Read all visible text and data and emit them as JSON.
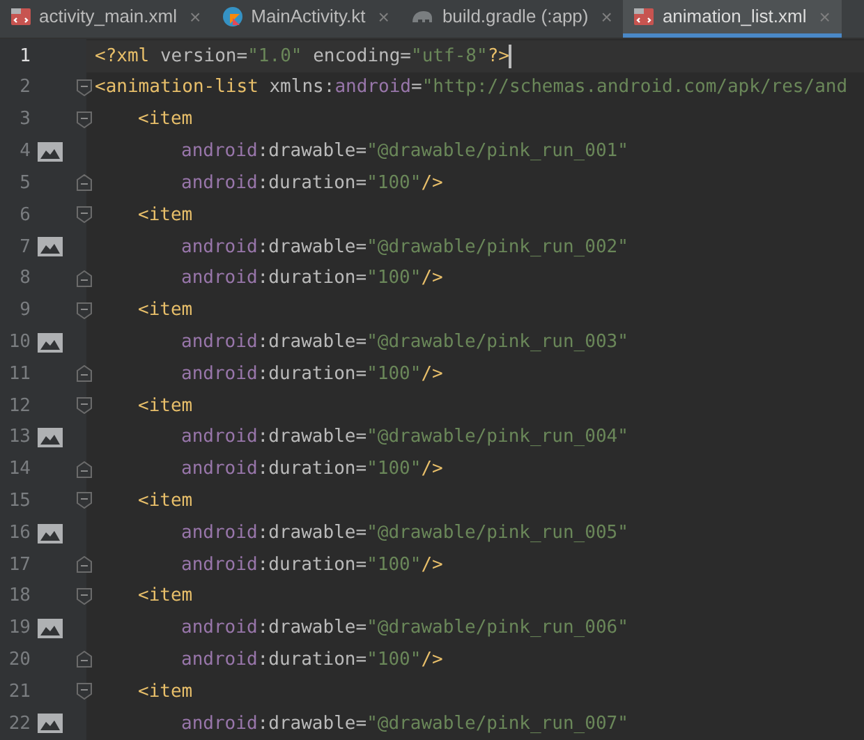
{
  "tabs": [
    {
      "label": "activity_main.xml",
      "kind": "xml",
      "selected": false,
      "close": "×"
    },
    {
      "label": "MainActivity.kt",
      "kind": "kotlin",
      "selected": false,
      "close": "×"
    },
    {
      "label": "build.gradle (:app)",
      "kind": "gradle",
      "selected": false,
      "close": "×"
    },
    {
      "label": "animation_list.xml",
      "kind": "xml",
      "selected": true,
      "close": "×"
    }
  ],
  "editor": {
    "lines": [
      {
        "number": "1",
        "current": true,
        "caret": true,
        "image": false,
        "kind": "declaration",
        "tokens": [
          {
            "kind": "tag",
            "t": "<?xml "
          },
          {
            "kind": "attr",
            "t": "version="
          },
          {
            "kind": "value",
            "t": "\"1.0\" "
          },
          {
            "kind": "attr",
            "t": "encoding="
          },
          {
            "kind": "value",
            "t": "\"utf-8\""
          },
          {
            "kind": "tag",
            "t": "?>"
          }
        ]
      },
      {
        "number": "2",
        "current": false,
        "caret": false,
        "image": false,
        "kind": "root_open",
        "tokens": [
          {
            "kind": "tag",
            "t": "<animation-list "
          },
          {
            "kind": "attr",
            "t": "xmlns:"
          },
          {
            "kind": "ns",
            "t": "android"
          },
          {
            "kind": "attr",
            "t": "="
          },
          {
            "kind": "value",
            "t": "\"http://schemas.android.com/apk/res/and"
          }
        ]
      },
      {
        "number": "3",
        "current": false,
        "caret": false,
        "image": false,
        "kind": "item_open",
        "tokens": [
          {
            "kind": "tag",
            "t": "<item"
          }
        ]
      },
      {
        "number": "4",
        "current": false,
        "caret": false,
        "image": true,
        "kind": "attribute",
        "tokens": [
          {
            "kind": "ns",
            "t": "android"
          },
          {
            "kind": "attr",
            "t": ":drawable="
          },
          {
            "kind": "value",
            "t": "\"@drawable/pink_run_001\""
          }
        ]
      },
      {
        "number": "5",
        "current": false,
        "caret": false,
        "image": false,
        "kind": "attribute_end",
        "tokens": [
          {
            "kind": "ns",
            "t": "android"
          },
          {
            "kind": "attr",
            "t": ":duration="
          },
          {
            "kind": "value",
            "t": "\"100\""
          },
          {
            "kind": "tag",
            "t": "/>"
          }
        ]
      },
      {
        "number": "6",
        "current": false,
        "caret": false,
        "image": false,
        "kind": "item_open",
        "tokens": [
          {
            "kind": "tag",
            "t": "<item"
          }
        ]
      },
      {
        "number": "7",
        "current": false,
        "caret": false,
        "image": true,
        "kind": "attribute",
        "tokens": [
          {
            "kind": "ns",
            "t": "android"
          },
          {
            "kind": "attr",
            "t": ":drawable="
          },
          {
            "kind": "value",
            "t": "\"@drawable/pink_run_002\""
          }
        ]
      },
      {
        "number": "8",
        "current": false,
        "caret": false,
        "image": false,
        "kind": "attribute_end",
        "tokens": [
          {
            "kind": "ns",
            "t": "android"
          },
          {
            "kind": "attr",
            "t": ":duration="
          },
          {
            "kind": "value",
            "t": "\"100\""
          },
          {
            "kind": "tag",
            "t": "/>"
          }
        ]
      },
      {
        "number": "9",
        "current": false,
        "caret": false,
        "image": false,
        "kind": "item_open",
        "tokens": [
          {
            "kind": "tag",
            "t": "<item"
          }
        ]
      },
      {
        "number": "10",
        "current": false,
        "caret": false,
        "image": true,
        "kind": "attribute",
        "tokens": [
          {
            "kind": "ns",
            "t": "android"
          },
          {
            "kind": "attr",
            "t": ":drawable="
          },
          {
            "kind": "value",
            "t": "\"@drawable/pink_run_003\""
          }
        ]
      },
      {
        "number": "11",
        "current": false,
        "caret": false,
        "image": false,
        "kind": "attribute_end",
        "tokens": [
          {
            "kind": "ns",
            "t": "android"
          },
          {
            "kind": "attr",
            "t": ":duration="
          },
          {
            "kind": "value",
            "t": "\"100\""
          },
          {
            "kind": "tag",
            "t": "/>"
          }
        ]
      },
      {
        "number": "12",
        "current": false,
        "caret": false,
        "image": false,
        "kind": "item_open",
        "tokens": [
          {
            "kind": "tag",
            "t": "<item"
          }
        ]
      },
      {
        "number": "13",
        "current": false,
        "caret": false,
        "image": true,
        "kind": "attribute",
        "tokens": [
          {
            "kind": "ns",
            "t": "android"
          },
          {
            "kind": "attr",
            "t": ":drawable="
          },
          {
            "kind": "value",
            "t": "\"@drawable/pink_run_004\""
          }
        ]
      },
      {
        "number": "14",
        "current": false,
        "caret": false,
        "image": false,
        "kind": "attribute_end",
        "tokens": [
          {
            "kind": "ns",
            "t": "android"
          },
          {
            "kind": "attr",
            "t": ":duration="
          },
          {
            "kind": "value",
            "t": "\"100\""
          },
          {
            "kind": "tag",
            "t": "/>"
          }
        ]
      },
      {
        "number": "15",
        "current": false,
        "caret": false,
        "image": false,
        "kind": "item_open",
        "tokens": [
          {
            "kind": "tag",
            "t": "<item"
          }
        ]
      },
      {
        "number": "16",
        "current": false,
        "caret": false,
        "image": true,
        "kind": "attribute",
        "tokens": [
          {
            "kind": "ns",
            "t": "android"
          },
          {
            "kind": "attr",
            "t": ":drawable="
          },
          {
            "kind": "value",
            "t": "\"@drawable/pink_run_005\""
          }
        ]
      },
      {
        "number": "17",
        "current": false,
        "caret": false,
        "image": false,
        "kind": "attribute_end",
        "tokens": [
          {
            "kind": "ns",
            "t": "android"
          },
          {
            "kind": "attr",
            "t": ":duration="
          },
          {
            "kind": "value",
            "t": "\"100\""
          },
          {
            "kind": "tag",
            "t": "/>"
          }
        ]
      },
      {
        "number": "18",
        "current": false,
        "caret": false,
        "image": false,
        "kind": "item_open",
        "tokens": [
          {
            "kind": "tag",
            "t": "<item"
          }
        ]
      },
      {
        "number": "19",
        "current": false,
        "caret": false,
        "image": true,
        "kind": "attribute",
        "tokens": [
          {
            "kind": "ns",
            "t": "android"
          },
          {
            "kind": "attr",
            "t": ":drawable="
          },
          {
            "kind": "value",
            "t": "\"@drawable/pink_run_006\""
          }
        ]
      },
      {
        "number": "20",
        "current": false,
        "caret": false,
        "image": false,
        "kind": "attribute_end",
        "tokens": [
          {
            "kind": "ns",
            "t": "android"
          },
          {
            "kind": "attr",
            "t": ":duration="
          },
          {
            "kind": "value",
            "t": "\"100\""
          },
          {
            "kind": "tag",
            "t": "/>"
          }
        ]
      },
      {
        "number": "21",
        "current": false,
        "caret": false,
        "image": false,
        "kind": "item_open",
        "tokens": [
          {
            "kind": "tag",
            "t": "<item"
          }
        ]
      },
      {
        "number": "22",
        "current": false,
        "caret": false,
        "image": true,
        "kind": "attribute",
        "tokens": [
          {
            "kind": "ns",
            "t": "android"
          },
          {
            "kind": "attr",
            "t": ":drawable="
          },
          {
            "kind": "value",
            "t": "\"@drawable/pink_run_007\""
          }
        ]
      }
    ]
  }
}
